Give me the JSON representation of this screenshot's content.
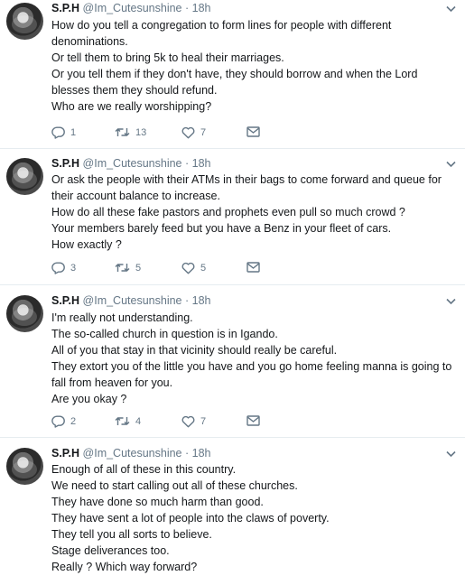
{
  "user": {
    "name": "S.P.H",
    "handle": "@Im_Cutesunshine",
    "separator": "·",
    "time": "18h"
  },
  "icons": {
    "caret": "chevron-down-icon",
    "reply": "reply-icon",
    "retweet": "retweet-icon",
    "like": "heart-icon",
    "dm": "envelope-icon"
  },
  "colors": {
    "muted": "#657786",
    "text": "#14171a",
    "divider": "#e6ecf0"
  },
  "tweets": [
    {
      "lines": [
        "How do you tell a congregation to form lines for people with different",
        "denominations.",
        "Or tell them to bring 5k to heal their marriages.",
        "Or you tell them if they don't have, they should borrow and when the Lord",
        "blesses them they should refund.",
        "Who are we really worshipping?"
      ],
      "replies": "1",
      "retweets": "13",
      "likes": "7"
    },
    {
      "lines": [
        "Or ask the people with their ATMs in their bags to come forward and queue for",
        "their account balance to increase.",
        "How do all these fake pastors and prophets even pull so much crowd ?",
        "Your members barely feed but you have a Benz in your fleet of cars.",
        "How exactly ?"
      ],
      "replies": "3",
      "retweets": "5",
      "likes": "5"
    },
    {
      "lines": [
        "I'm really not understanding.",
        "The so-called church in question is in Igando.",
        "All of you that stay in that vicinity should really be careful.",
        "They extort you of the little you have and you go home feeling manna is going to",
        "fall from heaven for you.",
        "Are you okay ?"
      ],
      "replies": "2",
      "retweets": "4",
      "likes": "7"
    },
    {
      "lines": [
        "Enough of all of these in this country.",
        "We need to start calling out all of these churches.",
        "They have done so much harm than good.",
        "They have sent a lot of people into the claws of poverty.",
        "They tell you all sorts to believe.",
        "Stage deliverances too.",
        "Really ? Which way forward?"
      ]
    }
  ]
}
